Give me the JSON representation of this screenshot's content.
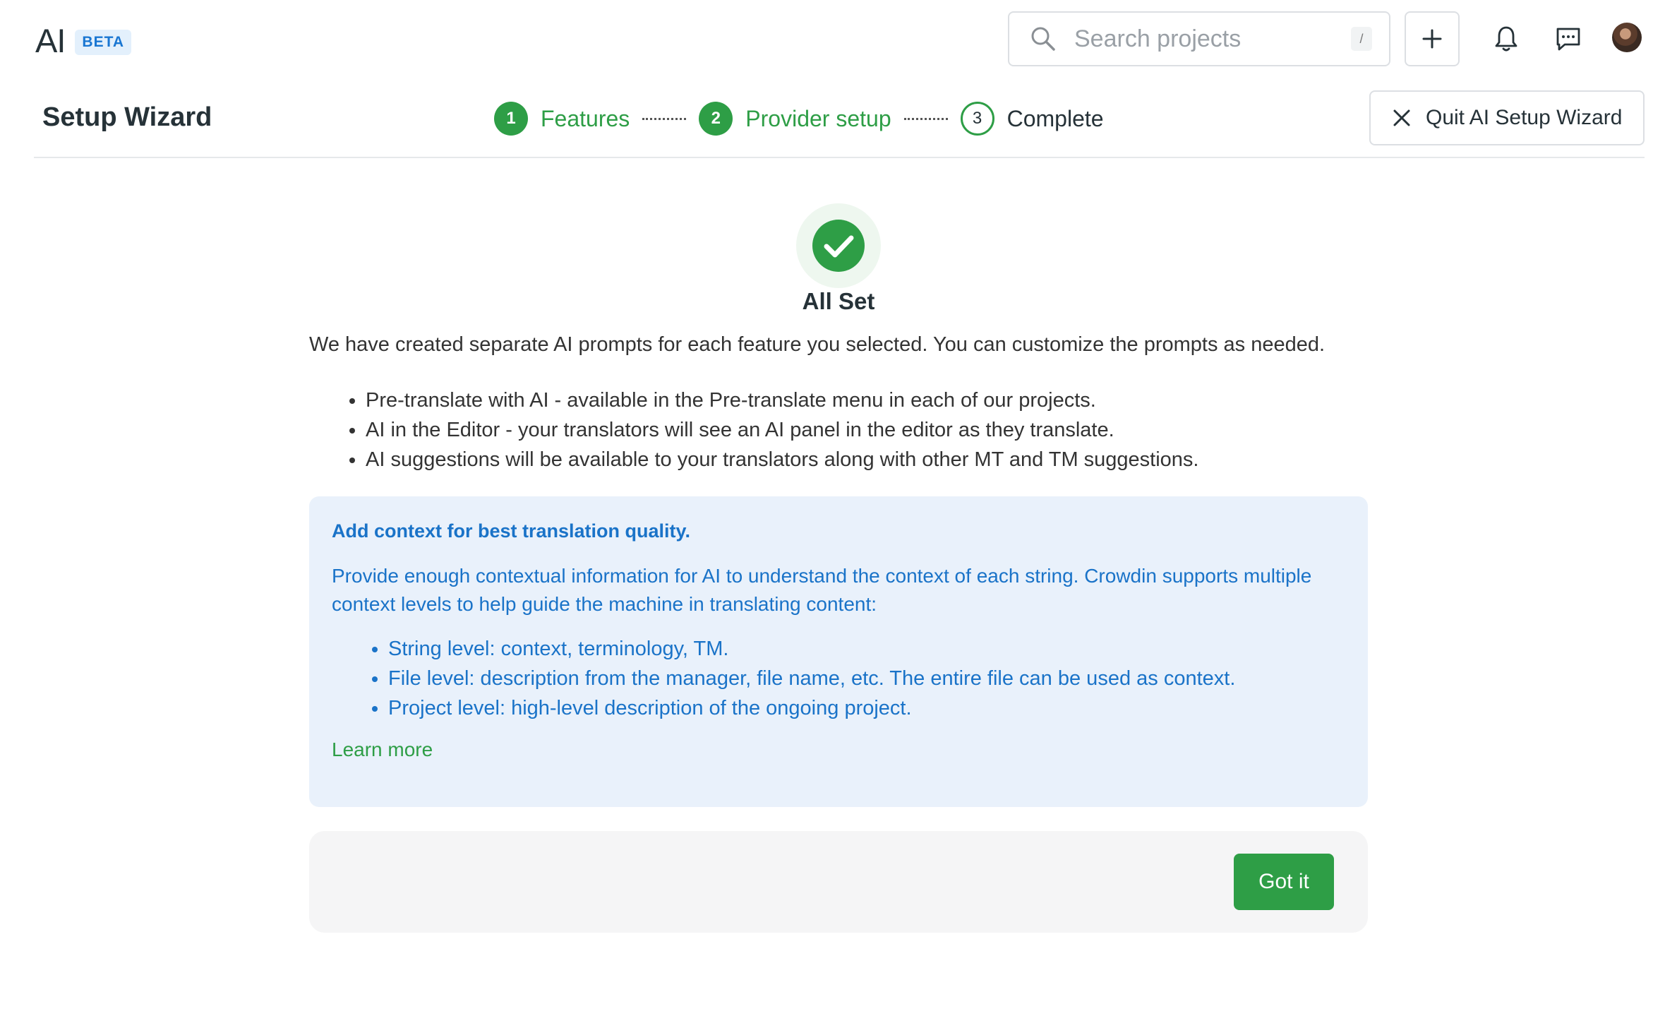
{
  "app": {
    "logo": "AI",
    "badge": "BETA"
  },
  "search": {
    "placeholder": "Search projects",
    "shortcut": "/"
  },
  "topbar": {
    "icons": [
      "plus-icon",
      "bell-icon",
      "chat-icon",
      "avatar"
    ]
  },
  "page": {
    "title": "Setup Wizard"
  },
  "steps": [
    {
      "number": "1",
      "label": "Features",
      "state": "done"
    },
    {
      "number": "2",
      "label": "Provider setup",
      "state": "done"
    },
    {
      "number": "3",
      "label": "Complete",
      "state": "current"
    }
  ],
  "quit": {
    "label": "Quit AI Setup Wizard"
  },
  "content": {
    "heading": "All Set",
    "intro": "We have created separate AI prompts for each feature you selected. You can customize the prompts as needed.",
    "features": [
      "Pre-translate with AI - available in the Pre-translate menu in each of our projects.",
      "AI in the Editor - your translators will see an AI panel in the editor as they translate.",
      "AI suggestions will be available to your translators along with other MT and TM suggestions."
    ]
  },
  "info": {
    "title": "Add context for best translation quality.",
    "description": "Provide enough contextual information for AI to understand the context of each string. Crowdin supports multiple context levels to help guide the machine in translating content:",
    "items": [
      "String level: context, terminology, TM.",
      "File level: description from the manager, file name, etc. The entire file can be used as context.",
      "Project level: high-level description of the ongoing project."
    ],
    "learn_more": "Learn more"
  },
  "footer": {
    "button": "Got it"
  },
  "colors": {
    "accent_green": "#2e9e46",
    "info_blue": "#1a73c8",
    "info_bg": "#e9f1fb",
    "badge_blue": "#1976d2"
  }
}
